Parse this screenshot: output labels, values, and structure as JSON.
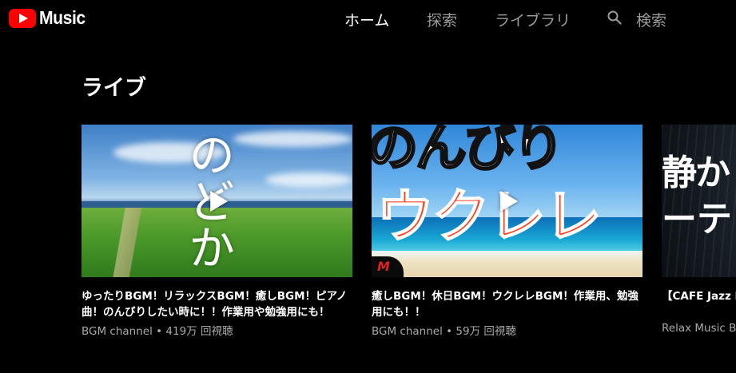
{
  "header": {
    "logo_text": "Music",
    "nav": [
      {
        "label": "ホーム",
        "active": true
      },
      {
        "label": "探索",
        "active": false
      },
      {
        "label": "ライブラリ",
        "active": false
      }
    ],
    "search_label": "検索"
  },
  "section": {
    "title": "ライブ"
  },
  "cards": [
    {
      "thumb_text": "のどか",
      "title": "ゆったりBGM！リラックスBGM！癒しBGM！ピアノ曲！のんびりしたい時に！！作業用や勉強用にも！",
      "subtitle": "BGM channel • 419万 回視聴"
    },
    {
      "thumb_text_top": "のんびり",
      "thumb_text_main": "ウクレレ",
      "badge_text": "M",
      "title": "癒しBGM！休日BGM！ウクレレBGM！作業用、勉強用にも！！",
      "subtitle": "BGM channel • 59万 回視聴"
    },
    {
      "thumb_text_1": "静か",
      "thumb_text_2": "ーテ",
      "title": "【CAFE Jazz Mズソング♪ 作",
      "subtitle": "Relax Music BG"
    }
  ],
  "colors": {
    "background": "#000000",
    "brand_red": "#ff0000",
    "nav_inactive": "#9a9a9a",
    "subtitle_gray": "#aaaaaa"
  }
}
